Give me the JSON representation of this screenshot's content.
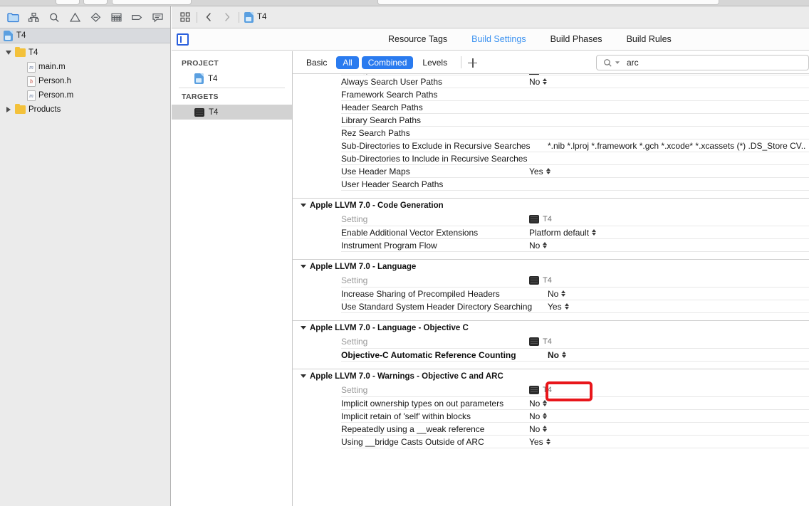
{
  "navigator": {
    "toolbar_icons": [
      {
        "name": "project-navigator-icon",
        "active": true
      },
      {
        "name": "source-control-navigator-icon",
        "active": false
      },
      {
        "name": "symbol-navigator-icon",
        "active": false
      },
      {
        "name": "issue-navigator-icon",
        "active": false
      },
      {
        "name": "test-navigator-icon",
        "active": false
      },
      {
        "name": "debug-navigator-icon",
        "active": false
      },
      {
        "name": "breakpoint-navigator-icon",
        "active": false
      },
      {
        "name": "report-navigator-icon",
        "active": false
      }
    ],
    "filter_bar_title": "T4",
    "tree": [
      {
        "label": "T4",
        "kind": "folder",
        "indent": 1,
        "disclosure": "open"
      },
      {
        "label": "main.m",
        "kind": "file-m",
        "indent": 2,
        "disclosure": "none"
      },
      {
        "label": "Person.h",
        "kind": "file-h",
        "indent": 2,
        "disclosure": "none"
      },
      {
        "label": "Person.m",
        "kind": "file-m",
        "indent": 2,
        "disclosure": "none"
      },
      {
        "label": "Products",
        "kind": "folder",
        "indent": 1,
        "disclosure": "closed"
      }
    ]
  },
  "jumpbar": {
    "related_items_icon": "related-items-icon",
    "back_label": "‹",
    "forward_label": "›",
    "crumb": "T4"
  },
  "tabs": {
    "items": [
      {
        "label": "Resource Tags",
        "active": false
      },
      {
        "label": "Build Settings",
        "active": true
      },
      {
        "label": "Build Phases",
        "active": false
      },
      {
        "label": "Build Rules",
        "active": false
      }
    ]
  },
  "project_list": {
    "project_header": "PROJECT",
    "project_items": [
      {
        "label": "T4",
        "selected": false
      }
    ],
    "targets_header": "TARGETS",
    "target_items": [
      {
        "label": "T4",
        "selected": true
      }
    ]
  },
  "filters": {
    "segments": [
      {
        "label": "Basic",
        "on": false
      },
      {
        "label": "All",
        "on": true
      },
      {
        "label": "Combined",
        "on": true
      },
      {
        "label": "Levels",
        "on": false
      }
    ],
    "add_label": "+",
    "search_value": "arc",
    "search_placeholder": ""
  },
  "settings": {
    "column_setting_label": "Setting",
    "column_target_label": "T4",
    "sections": [
      {
        "id": "search-paths-partial",
        "title": null,
        "partial_header": true,
        "rows": [
          {
            "name": "Always Search User Paths",
            "value": "No",
            "stepper": true
          },
          {
            "name": "Framework Search Paths",
            "value": "",
            "stepper": false
          },
          {
            "name": "Header Search Paths",
            "value": "",
            "stepper": false
          },
          {
            "name": "Library Search Paths",
            "value": "",
            "stepper": false
          },
          {
            "name": "Rez Search Paths",
            "value": "",
            "stepper": false
          },
          {
            "name": "Sub-Directories to Exclude in Recursive Searches",
            "value": "*.nib *.lproj *.framework *.gch *.xcode* *.xcassets (*) .DS_Store CV..",
            "stepper": false
          },
          {
            "name": "Sub-Directories to Include in Recursive Searches",
            "value": "",
            "stepper": false
          },
          {
            "name": "Use Header Maps",
            "value": "Yes",
            "stepper": true
          },
          {
            "name": "User Header Search Paths",
            "value": "",
            "stepper": false
          }
        ]
      },
      {
        "id": "code-generation",
        "title": "Apple LLVM 7.0 - Code Generation",
        "partial_header": false,
        "rows": [
          {
            "name": "Enable Additional Vector Extensions",
            "value": "Platform default",
            "stepper": true
          },
          {
            "name": "Instrument Program Flow",
            "value": "No",
            "stepper": true
          }
        ]
      },
      {
        "id": "language",
        "title": "Apple LLVM 7.0 - Language",
        "partial_header": false,
        "rows": [
          {
            "name": "Increase Sharing of Precompiled Headers",
            "value": "No",
            "stepper": true
          },
          {
            "name": "Use Standard System Header Directory Searching",
            "value": "Yes",
            "stepper": true
          }
        ]
      },
      {
        "id": "language-objective-c",
        "title": "Apple LLVM 7.0 - Language - Objective C",
        "partial_header": false,
        "rows": [
          {
            "name": "Objective-C Automatic Reference Counting",
            "value": "No",
            "stepper": true,
            "bold": true,
            "highlighted": true
          }
        ]
      },
      {
        "id": "warnings-objc-arc",
        "title": "Apple LLVM 7.0 - Warnings - Objective C and ARC",
        "partial_header": false,
        "rows": [
          {
            "name": "Implicit ownership types on out parameters",
            "value": "No",
            "stepper": true
          },
          {
            "name": "Implicit retain of 'self' within blocks",
            "value": "No",
            "stepper": true
          },
          {
            "name": "Repeatedly using a __weak reference",
            "value": "No",
            "stepper": true
          },
          {
            "name": "Using __bridge Casts Outside of ARC",
            "value": "Yes",
            "stepper": true
          }
        ]
      }
    ]
  },
  "annotation": {
    "highlight_color": "#e8161b",
    "highlight_target": "Objective-C Automatic Reference Counting value control"
  },
  "colors": {
    "accent_blue": "#2a7bef",
    "tab_active": "#3a91f0",
    "selection_gray": "#d2d2d2",
    "navigator_bg": "#ebebeb"
  }
}
